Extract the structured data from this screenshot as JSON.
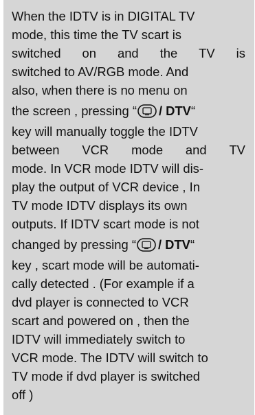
{
  "paragraph": {
    "l1": "When the IDTV is in DIGITAL TV",
    "l2": "mode, this time the TV scart is",
    "l3_words": [
      "switched",
      "on",
      "and",
      "the",
      "TV",
      "is"
    ],
    "l4": "switched to AV/RGB mode. And",
    "l5": "also, when there is no menu on",
    "l6_pre": "the screen , pressing “",
    "l6_key": " / DTV",
    "l6_post": "“",
    "l7": "key will manually toggle the IDTV",
    "l8_words": [
      "between",
      "VCR",
      "mode",
      "and",
      "TV"
    ],
    "l9": "mode. In VCR mode IDTV will dis-",
    "l10": "play the output of VCR device , In",
    "l11": "TV mode IDTV displays its own",
    "l12": "outputs. If IDTV scart mode is not",
    "l13_pre": "changed by pressing “",
    "l13_key": " / DTV",
    "l13_post": "“",
    "l14": "key , scart mode will be automati-",
    "l15": "cally detected . (For example if a",
    "l16": "dvd player is connected to VCR",
    "l17": "scart and powered on , then the",
    "l18": "IDTV will immediately switch to",
    "l19": "VCR mode. The IDTV will switch to",
    "l20": "TV mode if dvd player is switched",
    "l21": "off )"
  },
  "icons": {
    "tv_key": "tv-button-icon"
  }
}
